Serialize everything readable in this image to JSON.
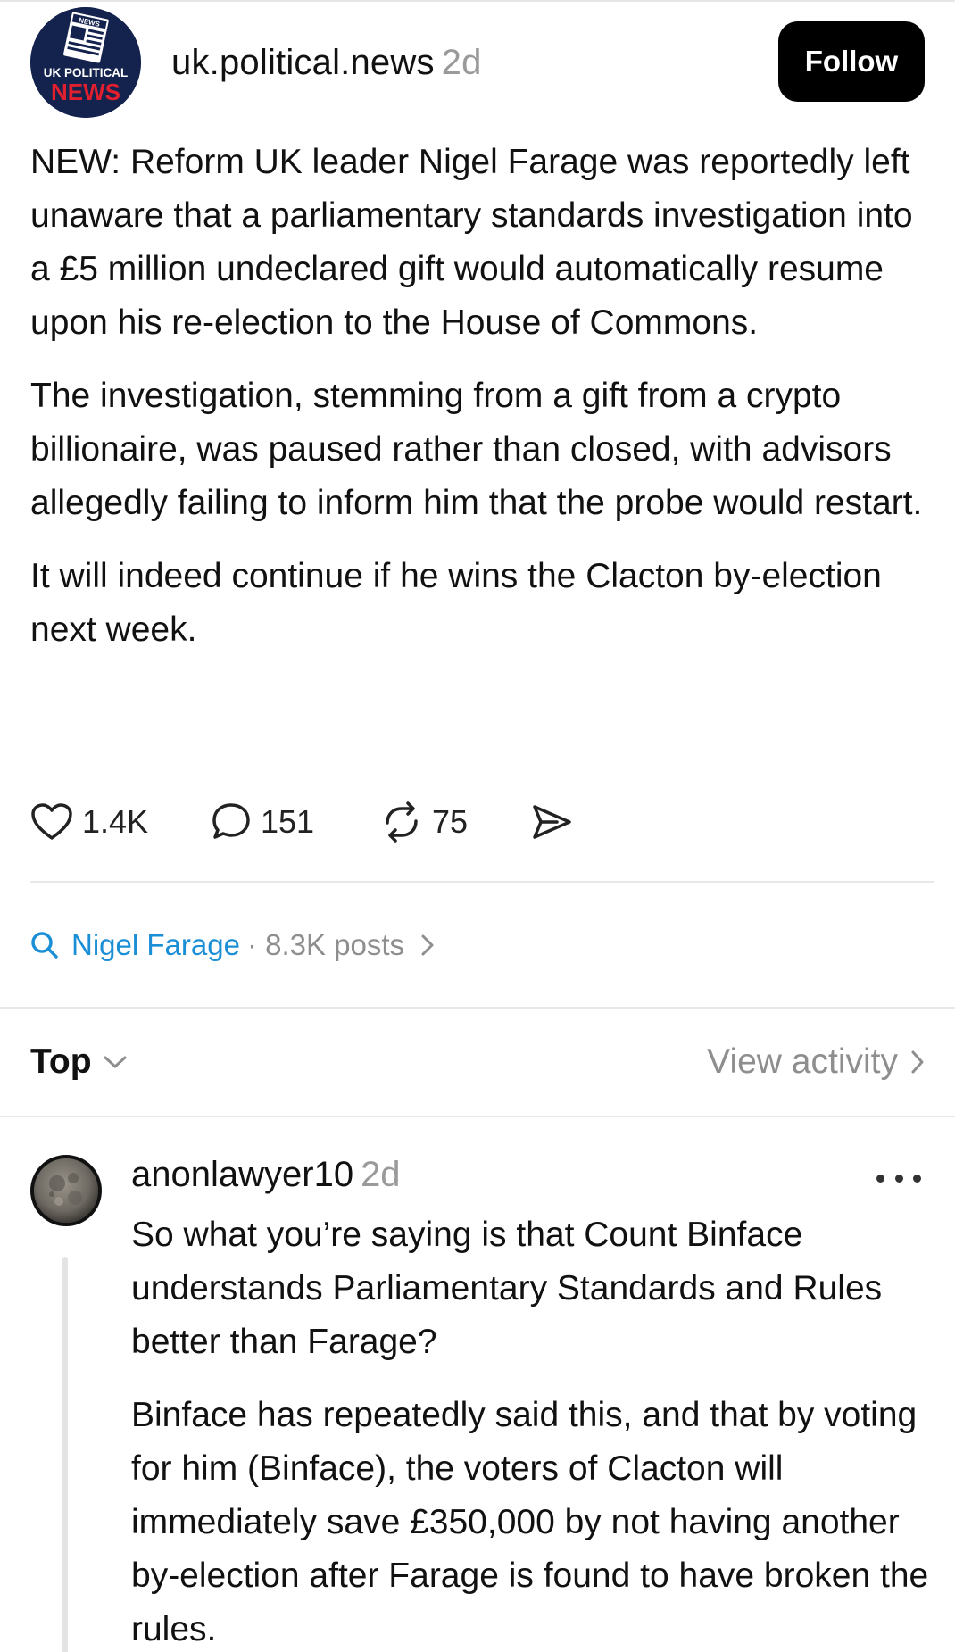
{
  "post": {
    "avatar_text_top": "NEWS",
    "avatar_text_mid": "UK POLITICAL",
    "avatar_text_bottom": "NEWS",
    "username": "uk.political.news",
    "time": "2d",
    "follow_label": "Follow",
    "paragraphs": [
      "NEW: Reform UK leader Nigel Farage was reportedly left unaware that a parliamentary standards investigation into a £5 million undeclared gift would automatically resume upon his re-election to the House of Commons.",
      "The investigation, stemming from a gift from a crypto billionaire, was paused rather than closed, with advisors allegedly failing to inform him that the probe would restart.",
      "It will indeed continue if he wins the Clacton by-election next week."
    ],
    "likes": "1.4K",
    "comments": "151",
    "reposts": "75"
  },
  "topic": {
    "name": "Nigel Farage",
    "count": "· 8.3K posts"
  },
  "sort": {
    "label": "Top",
    "view_activity": "View activity"
  },
  "reply": {
    "username": "anonlawyer10",
    "time": "2d",
    "paragraphs": [
      "So what you’re saying is that Count Binface understands Parliamentary Standards and Rules better than Farage?",
      "Binface has repeatedly said this, and that by voting for him (Binface), the voters of Clacton will immediately save £350,000 by not having another by-election after Farage is found to have broken the rules."
    ]
  },
  "colors": {
    "accent_link": "#1a8fd6",
    "muted": "#9a9a9a",
    "avatar_bg": "#14224e",
    "avatar_red": "#e0202e"
  },
  "icons": [
    "heart-icon",
    "comment-icon",
    "repost-icon",
    "share-icon",
    "search-icon",
    "chevron-right-icon",
    "chevron-down-icon",
    "more-icon"
  ]
}
